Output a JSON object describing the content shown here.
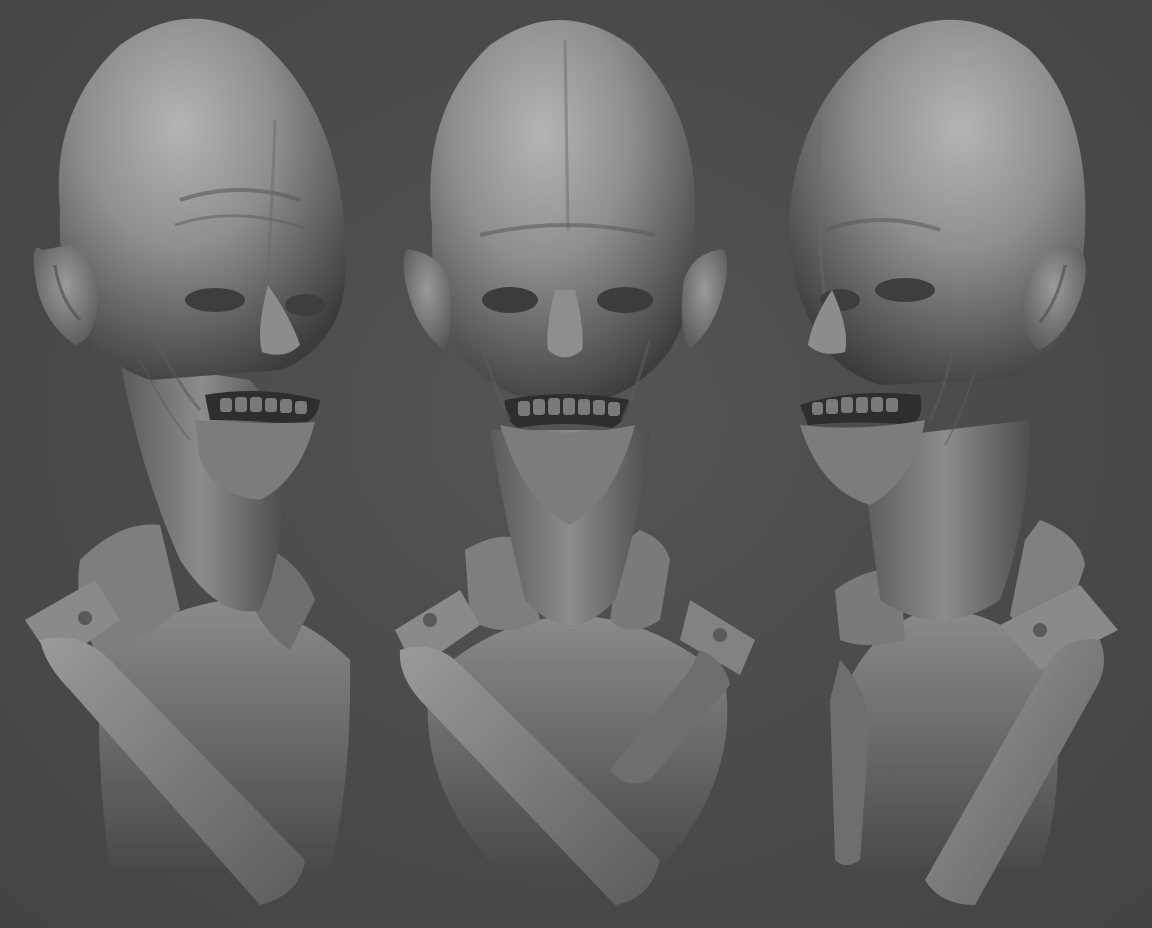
{
  "scene": {
    "background_color": "#4a4a4a",
    "material_color": "#8a8a8a",
    "views": [
      {
        "id": "three-quarter-left",
        "facing": "left-three-quarter"
      },
      {
        "id": "front",
        "facing": "front"
      },
      {
        "id": "three-quarter-right",
        "facing": "right-three-quarter"
      }
    ]
  }
}
